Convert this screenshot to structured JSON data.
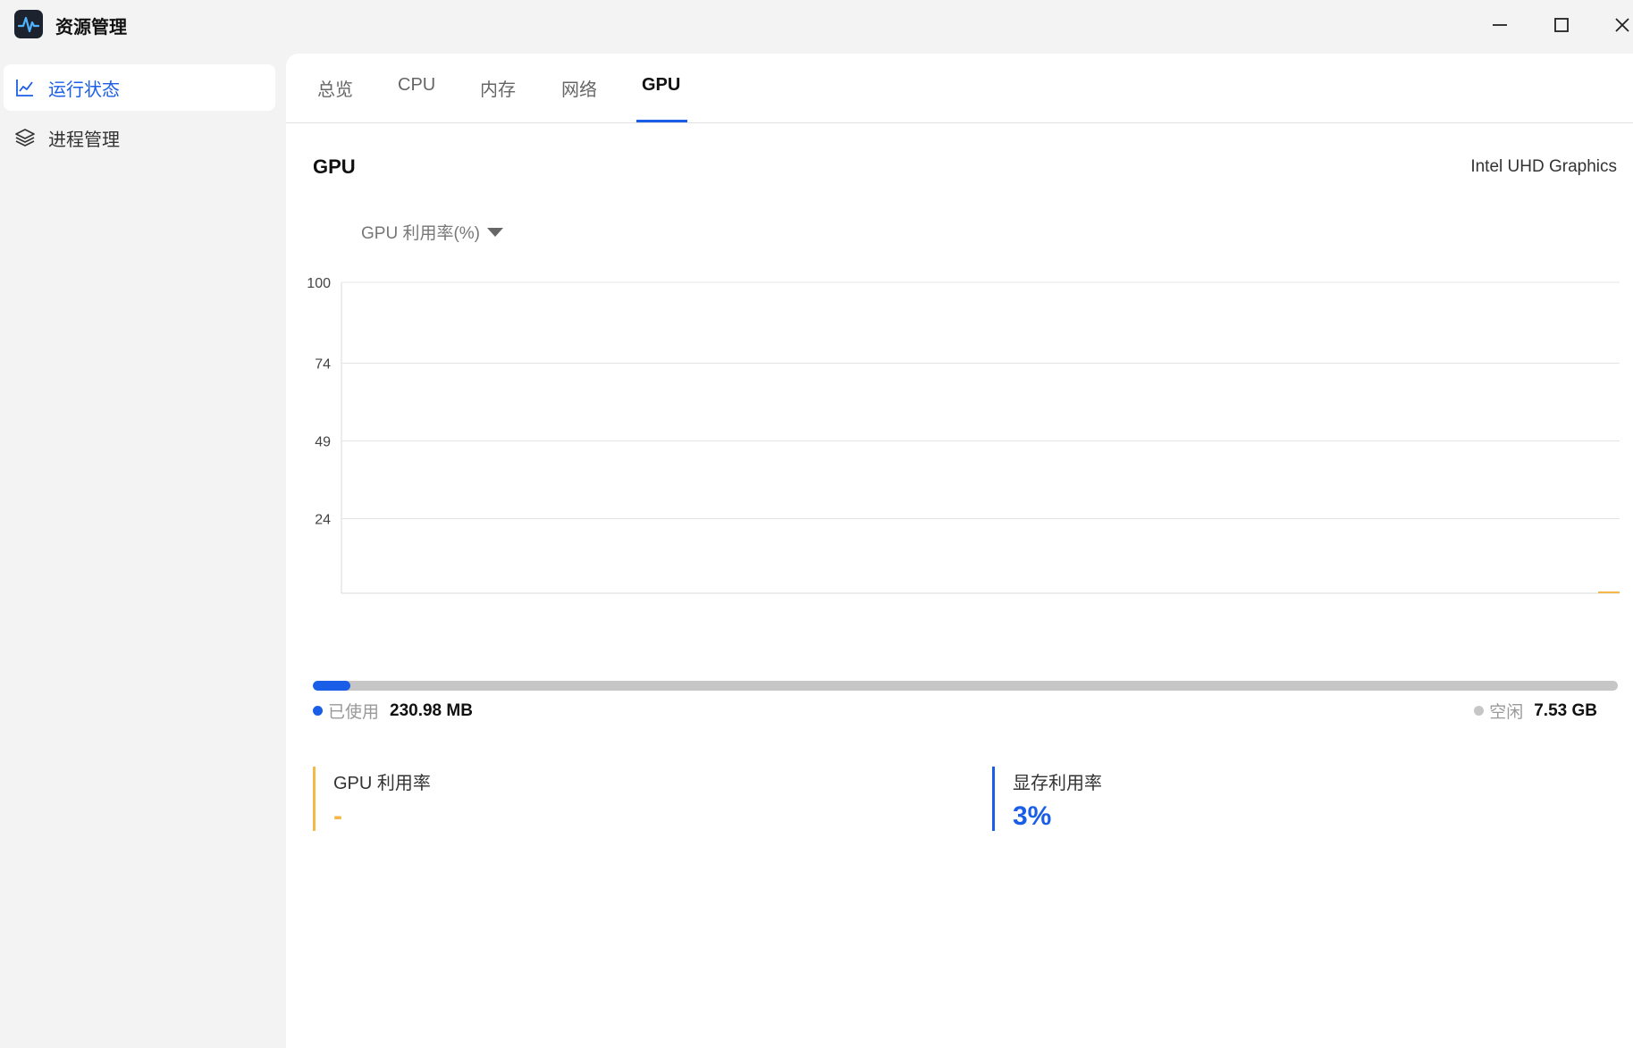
{
  "window": {
    "title": "资源管理",
    "app_icon": "pulse-icon",
    "controls": [
      "minimize-icon",
      "maximize-icon",
      "close-icon"
    ]
  },
  "sidebar": {
    "items": [
      {
        "label": "运行状态",
        "icon": "line-chart-icon",
        "active": true
      },
      {
        "label": "进程管理",
        "icon": "layers-icon",
        "active": false
      }
    ]
  },
  "tabs": [
    {
      "label": "总览",
      "active": false
    },
    {
      "label": "CPU",
      "active": false
    },
    {
      "label": "内存",
      "active": false
    },
    {
      "label": "网络",
      "active": false
    },
    {
      "label": "GPU",
      "active": true
    }
  ],
  "gpu": {
    "title": "GPU",
    "device": "Intel UHD Graphics",
    "metric_select": "GPU 利用率(%)"
  },
  "chart_data": {
    "type": "line",
    "title": "",
    "ylabel": "",
    "xlabel": "",
    "ylim": [
      0,
      100
    ],
    "y_ticks": [
      "100",
      "74",
      "49",
      "24"
    ],
    "y_tick_values": [
      100,
      74,
      49,
      24
    ],
    "grid": true,
    "series": [
      {
        "color": "#f5b94a",
        "values": [
          0,
          0
        ]
      }
    ]
  },
  "memory": {
    "used_fraction": 0.029,
    "used_label": "已使用",
    "used_value": "230.98 MB",
    "free_label": "空闲",
    "free_value": "7.53 GB",
    "used_color": "#1a5ee8",
    "free_color": "#c6c6c6"
  },
  "stats": {
    "gpu_util_label": "GPU 利用率",
    "gpu_util_value": "-",
    "gpu_util_color": "#f5b94a",
    "vram_util_label": "显存利用率",
    "vram_util_value": "3%",
    "vram_util_color": "#1a5ee8"
  }
}
